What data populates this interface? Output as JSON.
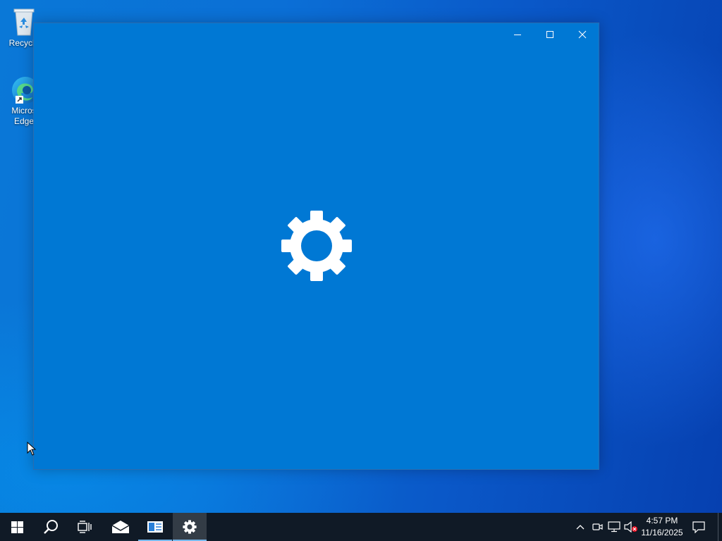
{
  "desktop": {
    "icons": [
      {
        "label": "Recycle",
        "icon": "recycle-bin-icon"
      },
      {
        "label_line1": "Micros",
        "label_line2": "Edge",
        "icon": "edge-icon"
      }
    ]
  },
  "window": {
    "app": "Settings",
    "controls": {
      "minimize": "minimize-icon",
      "maximize": "maximize-icon",
      "close": "close-icon"
    },
    "splash_icon": "gear-icon",
    "background": "#0078d4"
  },
  "taskbar": {
    "buttons": [
      {
        "name": "Start",
        "icon": "windows-logo-icon"
      },
      {
        "name": "Search",
        "icon": "search-icon"
      },
      {
        "name": "Task View",
        "icon": "task-view-icon"
      },
      {
        "name": "Mail",
        "icon": "mail-icon"
      },
      {
        "name": "Reader",
        "icon": "reader-icon"
      },
      {
        "name": "Settings",
        "icon": "gear-icon"
      }
    ],
    "tray": {
      "icons": [
        "chevron-up-icon",
        "meet-now-icon",
        "network-icon",
        "volume-muted-icon"
      ],
      "time": "4:57 PM",
      "date": "11/16/2025",
      "notification_icon": "action-center-icon"
    }
  },
  "colors": {
    "accent": "#0078d4",
    "taskbar": "#101a26",
    "running_indicator": "#76b9ed"
  }
}
